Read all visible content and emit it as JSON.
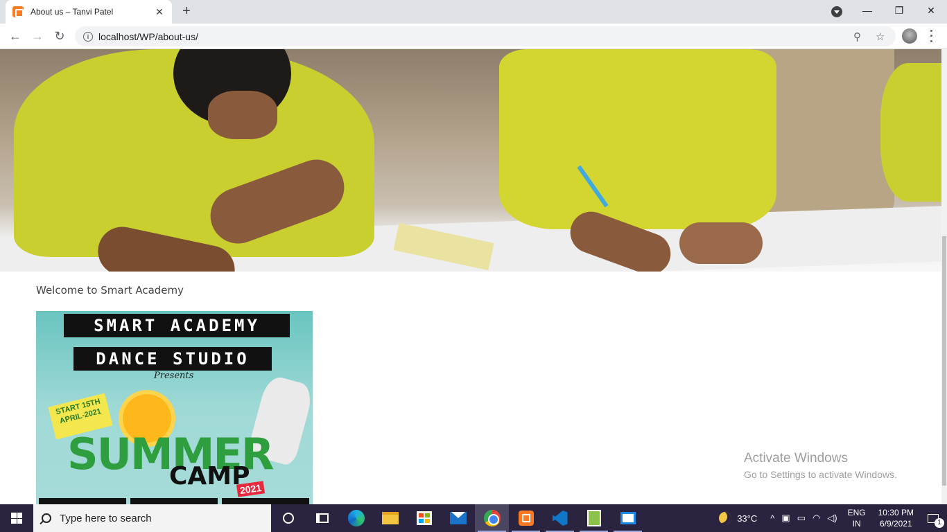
{
  "browser": {
    "tab_title": "About us – Tanvi Patel",
    "tab_close": "✕",
    "new_tab": "+",
    "url": "localhost/WP/about-us/",
    "back": "←",
    "forward": "→",
    "reload": "↻",
    "info": "i",
    "zoom_icon": "⚲",
    "star_icon": "☆",
    "window_minimize": "—",
    "window_restore": "❐",
    "window_close": "✕"
  },
  "page": {
    "welcome_text": "Welcome to Smart Academy",
    "poster": {
      "line1": "SMART ACADEMY",
      "line2": "DANCE STUDIO",
      "presents": "Presents",
      "start_badge": "START 15TH APRIL-2021",
      "summer": "SUMMER",
      "camp": "CAMP",
      "year": "2021"
    }
  },
  "watermark": {
    "title": "Activate Windows",
    "subtitle": "Go to Settings to activate Windows."
  },
  "taskbar": {
    "search_placeholder": "Type here to search",
    "pinned": [
      "cortana",
      "task-view",
      "edge",
      "file-explorer",
      "microsoft-store",
      "mail",
      "chrome",
      "xampp",
      "vscode",
      "notepad-plus-plus",
      "windows-app"
    ],
    "active_app": "chrome",
    "weather_temp": "33°C",
    "lang_line1": "ENG",
    "lang_line2": "IN",
    "time": "10:30 PM",
    "date": "6/9/2021",
    "notification_count": "1",
    "tray_chevron": "^"
  },
  "colors": {
    "chrome_tab_strip": "#dee1e6",
    "taskbar": "#2b2440",
    "xampp_orange": "#fb7a24",
    "shirt_yellow": "#c9cf2f"
  }
}
